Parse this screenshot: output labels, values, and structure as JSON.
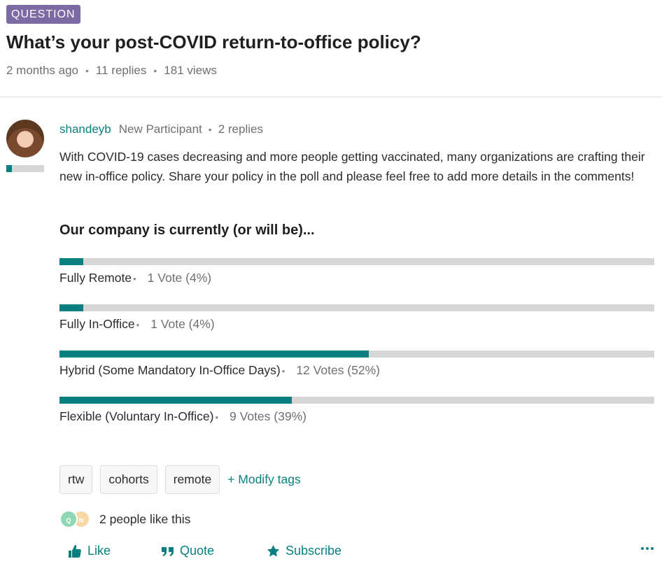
{
  "post": {
    "badge": "QUESTION",
    "title": "What’s your post-COVID return-to-office policy?",
    "meta": {
      "age": "2 months ago",
      "replies": "11 replies",
      "views": "181 views"
    }
  },
  "author": {
    "username": "shandeyb",
    "role": "New Participant",
    "replies": "2 replies",
    "rank_progress": 0.15
  },
  "body": "With COVID-19 cases decreasing and more people getting vaccinated, many organizations are crafting their new in-office policy. Share your policy in the poll and please feel free to add more details in the comments!",
  "poll": {
    "question": "Our company is currently (or will be)...",
    "options": [
      {
        "label": "Fully Remote",
        "votes": "1 Vote (4%)",
        "percent": 4
      },
      {
        "label": "Fully In-Office",
        "votes": "1 Vote (4%)",
        "percent": 4
      },
      {
        "label": "Hybrid (Some Mandatory In-Office Days)",
        "votes": "12 Votes (52%)",
        "percent": 52
      },
      {
        "label": "Flexible (Voluntary In-Office)",
        "votes": "9 Votes (39%)",
        "percent": 39
      }
    ]
  },
  "tags": [
    "rtw",
    "cohorts",
    "remote"
  ],
  "modify_tags": "+ Modify tags",
  "likes": {
    "avatars": [
      "Q",
      "N"
    ],
    "text": "2 people like this"
  },
  "actions": {
    "like": "Like",
    "quote": "Quote",
    "subscribe": "Subscribe"
  },
  "colors": {
    "accent": "#0a7f7f",
    "badge": "#7b6aa3",
    "track": "#d6d6d6"
  }
}
